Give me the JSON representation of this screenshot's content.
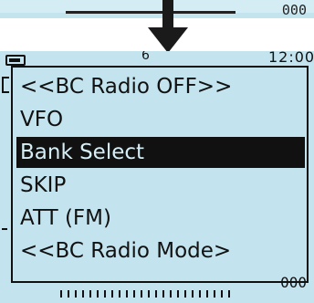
{
  "status": {
    "clock": "12:00",
    "glyph": "6",
    "bottom_value": "000",
    "prev_value": "000"
  },
  "menu": {
    "selected_index": 2,
    "items": [
      {
        "label": "<<BC Radio OFF>>"
      },
      {
        "label": "VFO"
      },
      {
        "label": "Bank Select"
      },
      {
        "label": "SKIP"
      },
      {
        "label": "ATT (FM)"
      },
      {
        "label": "<<BC Radio Mode>"
      }
    ]
  },
  "colors": {
    "lcd_background": "#c3e4ef",
    "selection_background": "#111111",
    "text": "#111111"
  },
  "icons": [
    "down-arrow-icon",
    "battery-icon"
  ]
}
